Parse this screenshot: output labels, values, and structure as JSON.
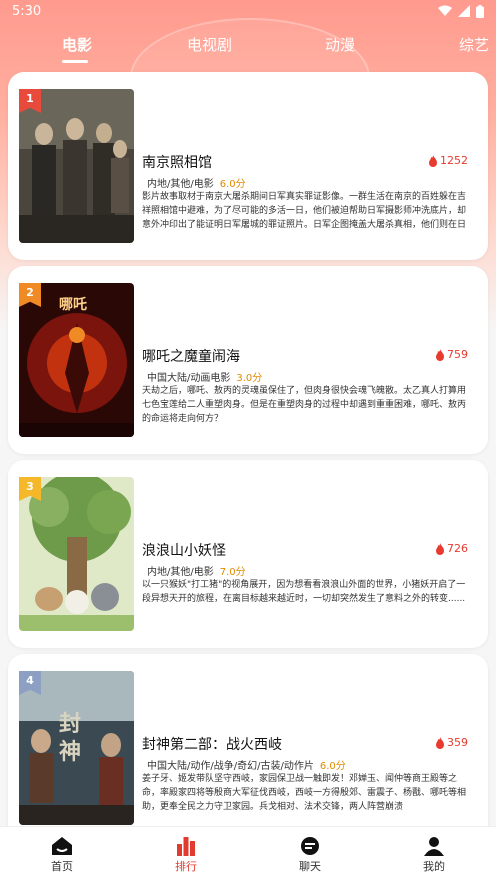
{
  "status_bar": {
    "time": "5:30"
  },
  "tabs": [
    {
      "label": "电影",
      "active": true
    },
    {
      "label": "电视剧",
      "active": false
    },
    {
      "label": "动漫",
      "active": false
    },
    {
      "label": "综艺",
      "active": false
    }
  ],
  "movies": [
    {
      "rank": "1",
      "rank_color": "#e84a3c",
      "title": "南京照相馆",
      "heat": "1252",
      "meta": "内地/其他/电影",
      "score": "6.0分",
      "desc": "影片故事取材于南京大屠杀期间日军真实罪证影像。一群生活在南京的百姓躲在吉祥照相馆中避难，为了尽可能的多活一日，他们被迫帮助日军摄影师冲洗底片，却意外冲印出了能证明日军屠城的罪证照片。日军企图掩盖大屠杀真相，他们则在日军眼皮底下谋划着..."
    },
    {
      "rank": "2",
      "rank_color": "#f08a24",
      "title": "哪吒之魔童闹海",
      "heat": "759",
      "meta": "中国大陆/动画电影",
      "score": "3.0分",
      "desc": "天劫之后，哪吒、敖丙的灵魂虽保住了，但肉身很快会魂飞魄散。太乙真人打算用七色宝莲给二人重塑肉身。但是在重塑肉身的过程中却遇到重重困难，哪吒、敖丙的命运将走向何方？"
    },
    {
      "rank": "3",
      "rank_color": "#f5b82a",
      "title": "浪浪山小妖怪",
      "heat": "726",
      "meta": "内地/其他/电影",
      "score": "7.0分",
      "desc": "以一只猴妖\"打工猪\"的视角展开，因为想看看浪浪山外面的世界，小猪妖开启了一段异想天开的旅程，在离目标越来越近时，一切却突然发生了意料之外的转变......"
    },
    {
      "rank": "4",
      "rank_color": "#8da0c4",
      "title": "封神第二部：战火西岐",
      "heat": "359",
      "meta": "中国大陆/动作/战争/奇幻/古装/动作片",
      "score": "6.0分",
      "desc": "姜子牙、姬发带队坚守西岐，家园保卫战一触即发！邓婵玉、闻仲等商王殿等之命，率殿家四将等殷商大军征伐西岐，西岐一方得殷郊、雷震子、杨戬、哪吒等相助，更奉全民之力守卫家园。兵戈相对、法术交锋，两人阵营崩溃"
    }
  ],
  "bottom_nav": [
    {
      "label": "首页",
      "icon": "home-icon",
      "active": false
    },
    {
      "label": "排行",
      "icon": "ranking-icon",
      "active": true
    },
    {
      "label": "聊天",
      "icon": "chat-icon",
      "active": false
    },
    {
      "label": "我的",
      "icon": "profile-icon",
      "active": false
    }
  ],
  "colors": {
    "accent": "#e03b2e",
    "header_gradient_top": "#ff9a8e",
    "score": "#e08a00"
  }
}
